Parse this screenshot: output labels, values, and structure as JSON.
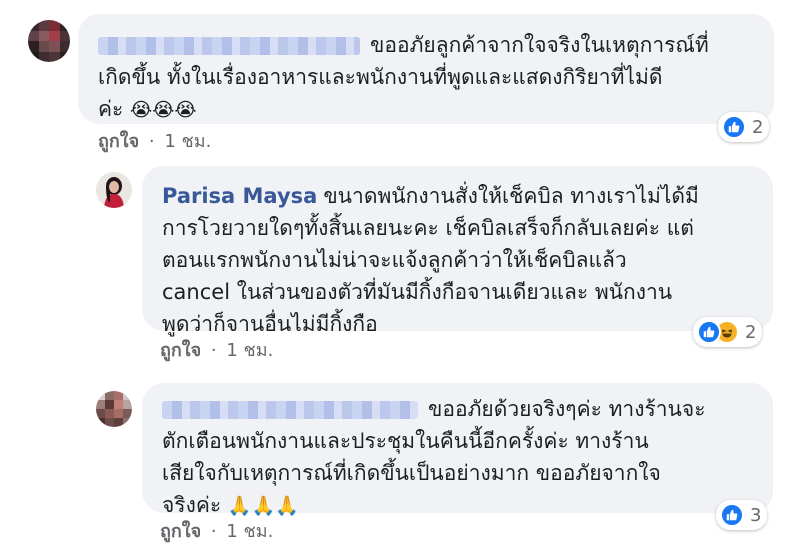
{
  "comments": [
    {
      "author": "",
      "text_lines": [
        "ขออภัยลูกค้าจากใจจริงในเหตุการณ์ที่",
        "เกิดขึ้น ทั้งในเรื่องอาหารและพนักงานที่พูดและแสดงกิริยาที่ไม่ดี",
        "ค่ะ"
      ],
      "emoji": "😭😭😭",
      "like_label": "ถูกใจ",
      "separator": "·",
      "time": "1 ชม.",
      "reaction_count": "2",
      "reaction_icons": [
        "like-icon"
      ]
    },
    {
      "author": "Parisa Maysa",
      "text_lines": [
        "ขนาดพนักงานสั่งให้เช็คบิล ทางเราไม่ได้มี",
        "การโวยวายใดๆทั้งสิ้นเลยนะคะ เช็คบิลเสร็จก็กลับเลยค่ะ แต่",
        "ตอนแรกพนักงานไม่น่าจะแจ้งลูกค้าว่าให้เช็คบิลแล้ว",
        "cancel ในส่วนของตัวที่มันมีกิ้งกือจานเดียวและ พนักงาน",
        "พูดว่าก็จานอื่นไม่มีกิ้งกือ"
      ],
      "like_label": "ถูกใจ",
      "separator": "·",
      "time": "1 ชม.",
      "reaction_count": "2",
      "reaction_icons": [
        "like-icon",
        "haha-icon"
      ]
    },
    {
      "author": "",
      "text_lines": [
        "ขออภัยด้วยจริงๆค่ะ ทางร้านจะ",
        "ตักเตือนพนักงานและประชุมในคืนนี้อีกครั้งค่ะ ทางร้าน",
        "เสียใจกับเหตุการณ์ที่เกิดขึ้นเป็นอย่างมาก ขออภัยจากใจ",
        "จริงค่ะ"
      ],
      "emoji": "🙏🙏🙏",
      "like_label": "ถูกใจ",
      "separator": "·",
      "time": "1 ชม.",
      "reaction_count": "3",
      "reaction_icons": [
        "like-icon"
      ]
    }
  ],
  "colors": {
    "bubble": "#f0f2f5",
    "author": "#385898",
    "meta": "#65676b",
    "like_blue": "#1877f2",
    "haha_yellow": "#f7b125"
  }
}
